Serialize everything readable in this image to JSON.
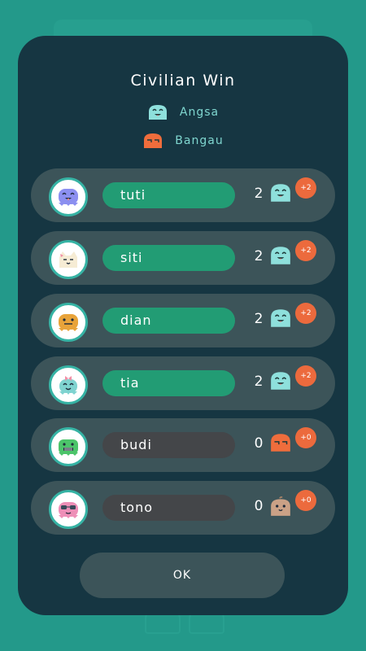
{
  "result": {
    "title": "Civilian Win"
  },
  "roles": [
    {
      "label": "Angsa",
      "icon": "teal-ghost-icon",
      "color": "#8ee0dc"
    },
    {
      "label": "Bangau",
      "icon": "orange-ghost-icon",
      "color": "#ef6d3c"
    }
  ],
  "players": [
    {
      "name": "tuti",
      "score": "2",
      "delta": "+2",
      "status": "winner",
      "avatar": "purple-monster-avatar-icon",
      "role_icon": "teal-ghost-icon"
    },
    {
      "name": "siti",
      "score": "2",
      "delta": "+2",
      "status": "winner",
      "avatar": "cream-cat-avatar-icon",
      "role_icon": "teal-ghost-icon"
    },
    {
      "name": "dian",
      "score": "2",
      "delta": "+2",
      "status": "winner",
      "avatar": "yellow-monster-avatar-icon",
      "role_icon": "teal-ghost-icon"
    },
    {
      "name": "tia",
      "score": "2",
      "delta": "+2",
      "status": "winner",
      "avatar": "teal-bow-avatar-icon",
      "role_icon": "teal-ghost-icon"
    },
    {
      "name": "budi",
      "score": "0",
      "delta": "+0",
      "status": "loser",
      "avatar": "green-monster-avatar-icon",
      "role_icon": "orange-ghost-icon"
    },
    {
      "name": "tono",
      "score": "0",
      "delta": "+0",
      "status": "loser",
      "avatar": "pink-glasses-avatar-icon",
      "role_icon": "brown-blob-icon"
    }
  ],
  "actions": {
    "ok_label": "OK"
  },
  "colors": {
    "background": "#23998a",
    "modal": "#163642",
    "row": "#3c5459",
    "winner_pill": "#229c74",
    "loser_pill": "#444649",
    "badge": "#ec6a3d"
  }
}
